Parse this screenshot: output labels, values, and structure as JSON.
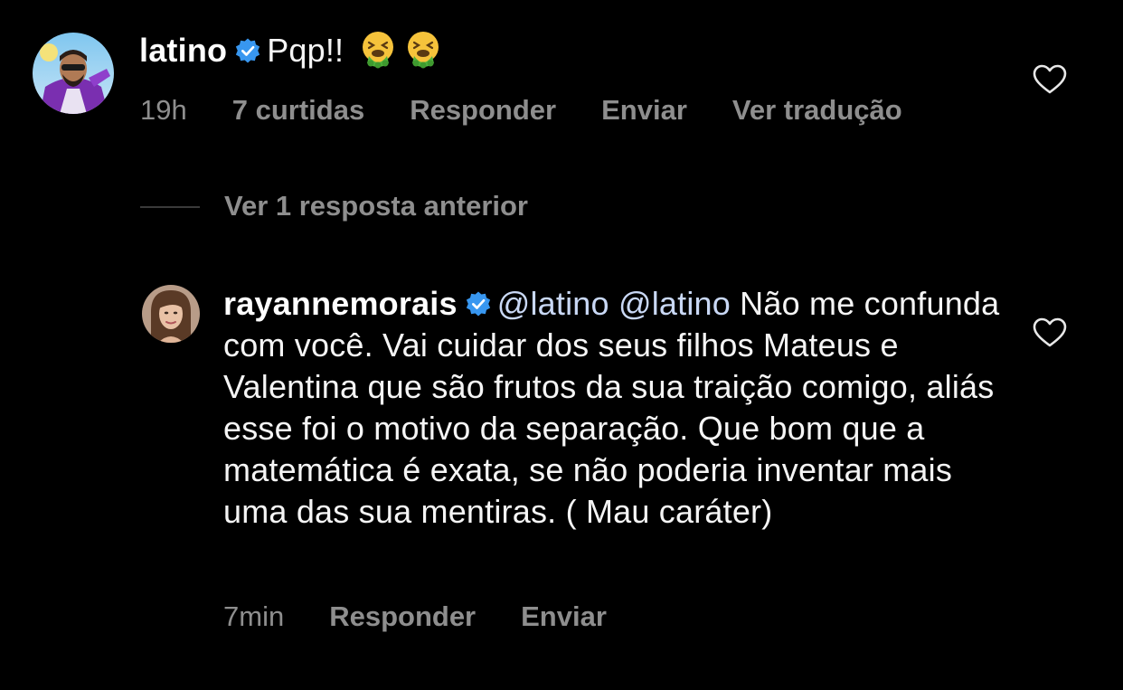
{
  "colors": {
    "background": "#000000",
    "text": "#f5f5f5",
    "muted": "#8e8e8e",
    "mention": "#c9d8f5",
    "verified": "#3897f0"
  },
  "comments": [
    {
      "username": "latino",
      "verified": true,
      "text": "Pqp!!",
      "emojis": [
        "nauseated-face-emoji",
        "nauseated-face-emoji"
      ],
      "time": "19h",
      "likes": "7 curtidas",
      "reply_label": "Responder",
      "send_label": "Enviar",
      "translate_label": "Ver tradução",
      "avatar_icon": "avatar-latino"
    },
    {
      "username": "rayannemorais",
      "verified": true,
      "mentions": [
        "@latino",
        "@latino"
      ],
      "text": "Não me confunda com você. Vai cuidar dos seus filhos Mateus e Valentina que são frutos da sua traição comigo, aliás esse foi o motivo da separação. Que bom que a matemática é exata, se não poderia inventar mais uma das sua mentiras. ( Mau caráter)",
      "time": "7min",
      "reply_label": "Responder",
      "send_label": "Enviar",
      "avatar_icon": "avatar-rayannemorais"
    }
  ],
  "replies_link": "Ver 1 resposta anterior",
  "icons": {
    "like": "heart-outline-icon",
    "verified": "verified-badge-icon"
  }
}
